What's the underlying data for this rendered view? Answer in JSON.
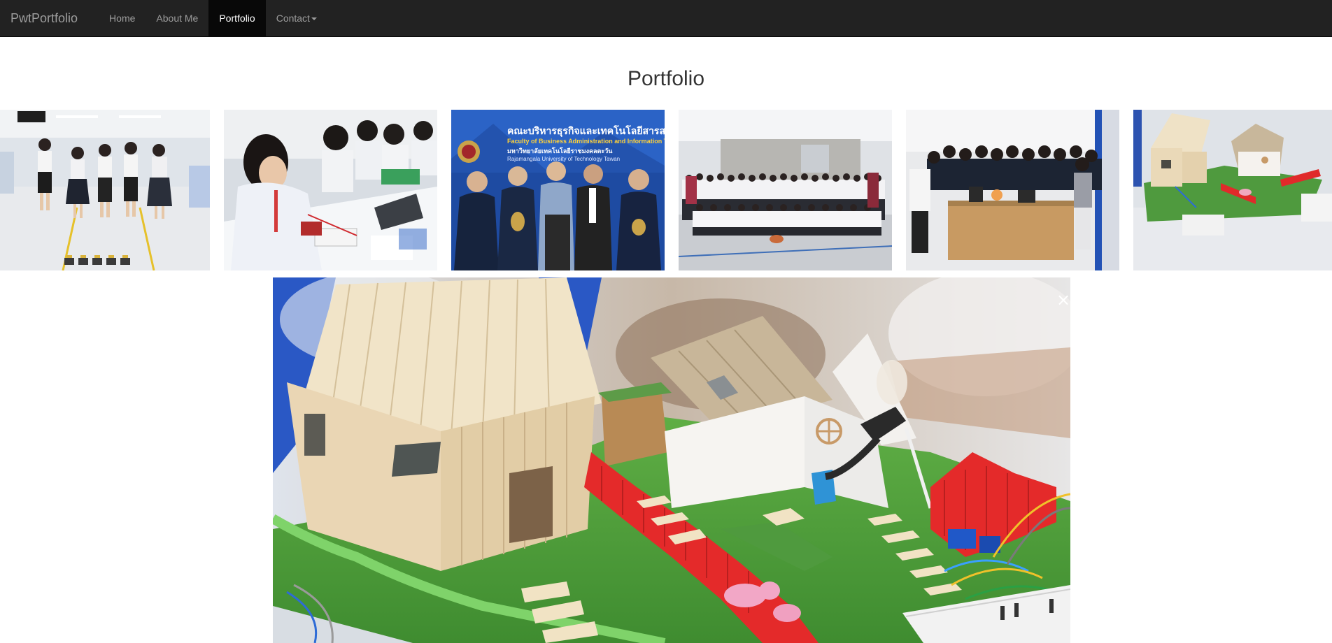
{
  "navbar": {
    "brand": "PwtPortfolio",
    "items": [
      {
        "label": "Home",
        "active": false
      },
      {
        "label": "About Me",
        "active": false
      },
      {
        "label": "Portfolio",
        "active": true
      },
      {
        "label": "Contact",
        "active": false,
        "dropdown": true
      }
    ]
  },
  "page": {
    "title": "Portfolio"
  },
  "thumbnails": [
    {
      "subject": "students standing with robot cars"
    },
    {
      "subject": "students working at electronics bench"
    },
    {
      "subject": "group photo in front of faculty banner"
    },
    {
      "subject": "large group photo in hall"
    },
    {
      "subject": "group photo around project table"
    },
    {
      "subject": "model house project"
    }
  ],
  "banner": {
    "thai_line": "คณะบริหารธุรกิจและเทคโนโลยีสารสนเ",
    "english_line": "Faculty of Business Administration and Information Techno",
    "thai_line2": "มหาวิทยาลัยเทคโนโลยีราชมงคลตะวัน",
    "english_line2": "Rajamangala University of Technology Tawan"
  },
  "lightbox": {
    "close_symbol": "×",
    "subject": "model house project"
  },
  "colors": {
    "navbar_bg": "#222222",
    "nav_active_bg": "#080808",
    "nav_text": "#9d9d9d",
    "nav_active_text": "#ffffff",
    "banner_blue": "#1f4fa8"
  }
}
